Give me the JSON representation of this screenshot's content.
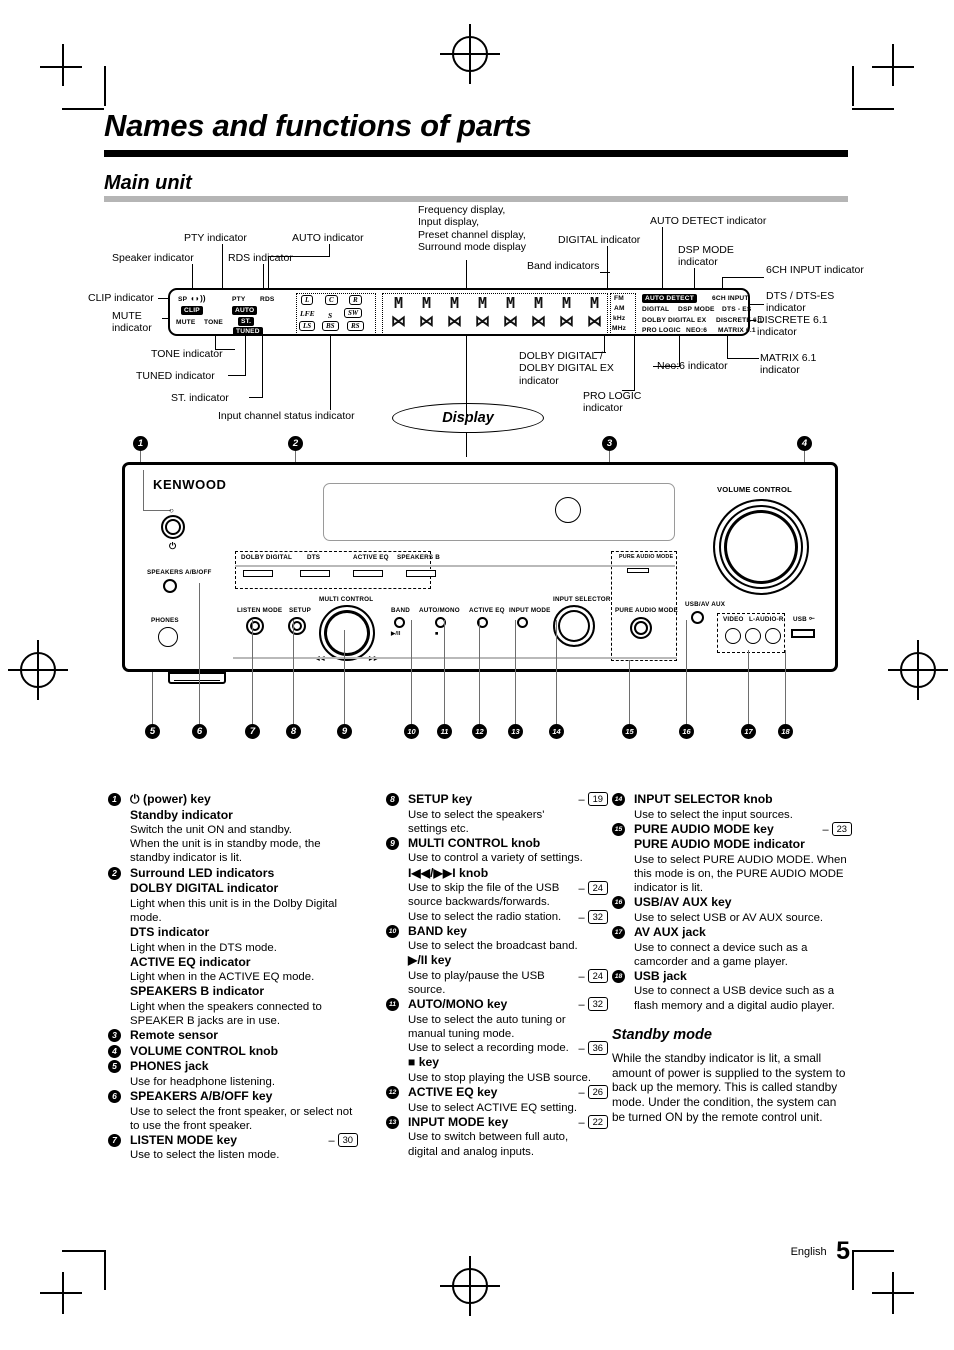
{
  "document": {
    "title": "Names and functions of parts",
    "section": "Main unit",
    "footer_language": "English",
    "footer_page": "5"
  },
  "display_diagram": {
    "callout_label": "Display",
    "labels_left": [
      "Speaker indicator",
      "PTY indicator",
      "RDS indicator",
      "AUTO indicator",
      "CLIP indicator",
      "MUTE\nindicator",
      "TONE indicator",
      "TUNED indicator",
      "ST. indicator",
      "Input channel status indicator"
    ],
    "labels_center": "Frequency display,\nInput display,\nPreset channel display,\nSurround mode display",
    "labels_right": [
      "DIGITAL indicator",
      "Band indicators",
      "AUTO DETECT indicator",
      "DSP MODE\nindicator",
      "6CH INPUT indicator",
      "DTS / DTS-ES\nindicator",
      "DISCRETE 6.1\nindicator",
      "MATRIX 6.1\nindicator",
      "DOLBY DIGITAL /\nDOLBY DIGITAL EX\nindicator",
      "PRO LOGIC\nindicator",
      "Neo:6 indicator"
    ],
    "lcd_indicators": {
      "sp": "SP",
      "clip": "CLIP",
      "mute": "MUTE",
      "tone": "TONE",
      "pty": "PTY",
      "rds": "RDS",
      "auto": "AUTO",
      "st": "ST.",
      "tuned": "TUNED",
      "auto_detect": "AUTO DETECT",
      "digital": "DIGITAL",
      "dsp_mode": "DSP MODE",
      "six_ch_input": "6CH INPUT",
      "dts_es": "DTS - ES",
      "dolby_digital_ex": "DOLBY DIGITAL EX",
      "discrete": "DISCRETE 6.1",
      "pro_logic": "PRO LOGIC",
      "neo6": "NEO:6",
      "matrix": "MATRIX 6.1"
    },
    "channel_boxes": [
      "L",
      "C",
      "R",
      "LFE",
      "S",
      "SW",
      "LS",
      "BS",
      "RS"
    ],
    "band_units": [
      "FM",
      "AM",
      "kHz",
      "MHz"
    ],
    "matrix_cells": [
      "M",
      "M",
      "M",
      "M",
      "M",
      "M",
      "M",
      "M"
    ]
  },
  "front_panel": {
    "brand": "KENWOOD",
    "labels": {
      "speakers_ab_off": "SPEAKERS A/B/OFF",
      "phones": "PHONES",
      "multi_control": "MULTI CONTROL",
      "listen_mode": "LISTEN MODE",
      "setup": "SETUP",
      "band": "BAND",
      "auto_mono": "AUTO/MONO",
      "active_eq": "ACTIVE EQ",
      "input_mode": "INPUT MODE",
      "input_selector": "INPUT SELECTOR",
      "pure_audio_mode": "PURE AUDIO MODE",
      "volume_control": "VOLUME CONTROL",
      "usb_av_aux": "USB/AV AUX",
      "video": "VIDEO",
      "l_audio_r": "L-AUDIO-R",
      "usb": "USB",
      "skip_back": "◀◀",
      "skip_fwd": "▶▶",
      "play_pause": "▶/II",
      "stop": "■"
    },
    "led_indicators": [
      "DOLBY DIGITAL",
      "DTS",
      "ACTIVE EQ",
      "SPEAKERS B"
    ],
    "callouts_top": [
      "1",
      "2",
      "3",
      "4"
    ],
    "callouts_bottom": [
      "5",
      "6",
      "7",
      "8",
      "9",
      "10",
      "11",
      "12",
      "13",
      "14",
      "15",
      "16",
      "17",
      "18"
    ]
  },
  "descriptions": {
    "column1": [
      {
        "num": "1",
        "headings": [
          "⏻ (power) key",
          "Standby indicator"
        ],
        "body": [
          "Switch the unit ON and standby.",
          "When the unit is in standby mode, the standby indicator is lit."
        ]
      },
      {
        "num": "2",
        "headings": [
          "Surround LED indicators",
          "DOLBY DIGITAL indicator"
        ],
        "body": [
          "Light when this unit is in the Dolby Digital mode."
        ],
        "subs": [
          {
            "heading": "DTS indicator",
            "body": "Light when in the DTS mode."
          },
          {
            "heading": "ACTIVE EQ indicator",
            "body": "Light when in the ACTIVE EQ mode."
          },
          {
            "heading": "SPEAKERS B indicator",
            "body": "Light when the speakers connected to SPEAKER B jacks are in use."
          }
        ]
      },
      {
        "num": "3",
        "headings": [
          "Remote sensor"
        ],
        "body": []
      },
      {
        "num": "4",
        "headings": [
          "VOLUME CONTROL knob"
        ],
        "body": []
      },
      {
        "num": "5",
        "headings": [
          "PHONES jack"
        ],
        "body": [
          "Use for headphone listening."
        ]
      },
      {
        "num": "6",
        "headings": [
          "SPEAKERS A/B/OFF key"
        ],
        "body": [
          "Use to select the front speaker, or select not to use the front speaker."
        ]
      },
      {
        "num": "7",
        "headings": [
          "LISTEN MODE key"
        ],
        "ref": "30",
        "body": [
          "Use to select the listen mode."
        ]
      }
    ],
    "column2": [
      {
        "num": "8",
        "headings": [
          "SETUP key"
        ],
        "ref": "19",
        "body": [
          "Use to select the speakers' settings etc."
        ]
      },
      {
        "num": "9",
        "headings": [
          "MULTI CONTROL knob"
        ],
        "body": [
          "Use to control a variety of settings."
        ],
        "subs": [
          {
            "heading": "I◀◀/▶▶I knob",
            "body": "Use to skip the file of the USB source backwards/forwards.",
            "ref": "24"
          },
          {
            "heading": "",
            "body": "Use to select the radio station.",
            "ref": "32"
          }
        ]
      },
      {
        "num": "10",
        "headings": [
          "BAND key"
        ],
        "body": [
          "Use to select the broadcast band."
        ],
        "subs": [
          {
            "heading": "▶/II key",
            "body": "Use to play/pause the USB source.",
            "ref": "24"
          }
        ]
      },
      {
        "num": "11",
        "headings": [
          "AUTO/MONO key"
        ],
        "body": [
          "Use to select the auto tuning or manual tuning mode."
        ],
        "ref": "32",
        "subs": [
          {
            "heading": "",
            "body": "Use to select a recording mode.",
            "ref": "36"
          },
          {
            "heading": "■ key",
            "body": "Use to stop playing the USB source."
          }
        ]
      },
      {
        "num": "12",
        "headings": [
          "ACTIVE EQ key"
        ],
        "ref": "26",
        "body": [
          "Use to select ACTIVE EQ setting."
        ]
      },
      {
        "num": "13",
        "headings": [
          "INPUT MODE key"
        ],
        "ref": "22",
        "body": [
          "Use to switch between full auto, digital and analog inputs."
        ]
      }
    ],
    "column3": [
      {
        "num": "14",
        "headings": [
          "INPUT SELECTOR knob"
        ],
        "body": [
          "Use to select the input sources."
        ]
      },
      {
        "num": "15",
        "headings": [
          "PURE AUDIO MODE key",
          "PURE AUDIO MODE indicator"
        ],
        "ref": "23",
        "body": [
          "Use to select PURE AUDIO MODE. When this mode is on, the PURE AUDIO MODE indicator is lit."
        ]
      },
      {
        "num": "16",
        "headings": [
          "USB/AV AUX key"
        ],
        "body": [
          "Use to select USB or AV AUX source."
        ]
      },
      {
        "num": "17",
        "headings": [
          "AV AUX jack"
        ],
        "body": [
          "Use to connect a device such as a camcorder and a game player."
        ]
      },
      {
        "num": "18",
        "headings": [
          "USB jack"
        ],
        "body": [
          "Use to connect a USB device such as a flash memory and a digital audio player."
        ]
      }
    ],
    "standby": {
      "heading": "Standby mode",
      "body": "While the standby indicator is lit, a small amount of power is supplied to the system to back up the memory. This is called standby mode. Under the condition, the system can be turned ON by the remote control unit."
    }
  }
}
